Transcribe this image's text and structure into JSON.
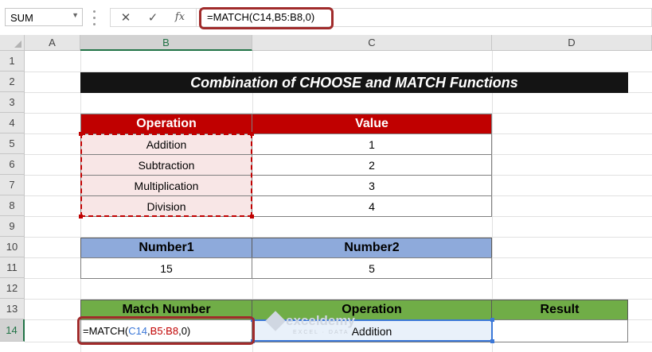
{
  "formula_bar": {
    "name_box": "SUM",
    "cancel_icon": "close-icon",
    "enter_icon": "check-icon",
    "fx_label": "fx",
    "formula": "=MATCH(C14,B5:B8,0)"
  },
  "columns": [
    "A",
    "B",
    "C",
    "D"
  ],
  "rows": [
    "1",
    "2",
    "3",
    "4",
    "5",
    "6",
    "7",
    "8",
    "9",
    "10",
    "11",
    "12",
    "13",
    "14"
  ],
  "title": "Combination of CHOOSE and MATCH Functions",
  "table1": {
    "headers": [
      "Operation",
      "Value"
    ],
    "rows": [
      [
        "Addition",
        "1"
      ],
      [
        "Subtraction",
        "2"
      ],
      [
        "Multiplication",
        "3"
      ],
      [
        "Division",
        "4"
      ]
    ]
  },
  "table2": {
    "headers": [
      "Number1",
      "Number2"
    ],
    "values": [
      "15",
      "5"
    ]
  },
  "table3": {
    "headers": [
      "Match Number",
      "Operation",
      "Result"
    ],
    "edit_prefix": "=MATCH(",
    "edit_ref1": "C14",
    "edit_comma1": ",",
    "edit_ref2": "B5:B8",
    "edit_suffix": ",0)",
    "operation": "Addition",
    "result": ""
  },
  "watermark": {
    "name": "exceldemy",
    "sub": "EXCEL · DATA · BI"
  },
  "colors": {
    "header_red": "#c00000",
    "header_blue": "#8eaadb",
    "header_green": "#70ad47",
    "title_bg": "#141414",
    "highlight": "#a02b2b"
  }
}
